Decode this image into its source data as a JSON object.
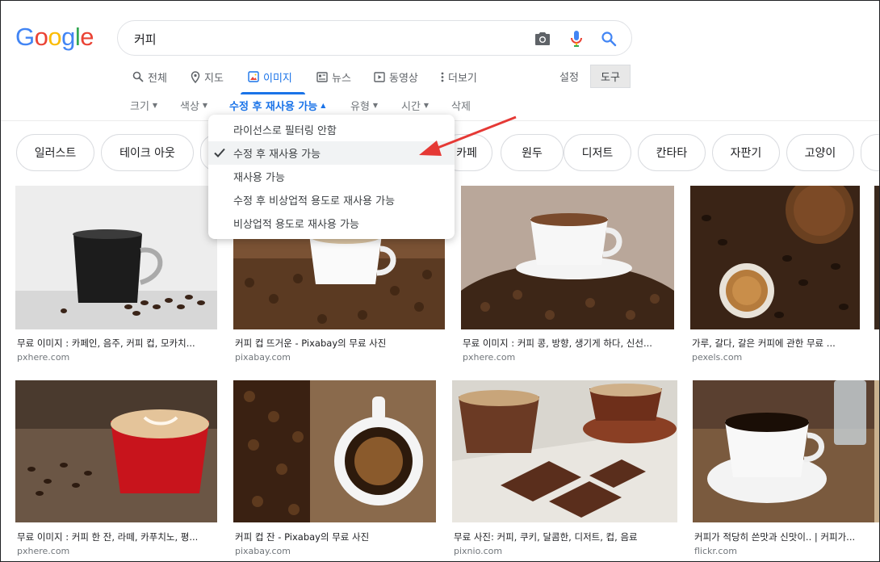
{
  "search": {
    "query": "커피"
  },
  "logo_letters": [
    "G",
    "o",
    "o",
    "g",
    "l",
    "e"
  ],
  "colors": {
    "accent": "#1a73e8",
    "logo": [
      "#4285F4",
      "#EA4335",
      "#FBBC05",
      "#4285F4",
      "#34A853",
      "#EA4335"
    ],
    "arrow": "#e53935"
  },
  "tabs": [
    {
      "label": "전체",
      "icon": "search-icon"
    },
    {
      "label": "지도",
      "icon": "map-pin-icon"
    },
    {
      "label": "이미지",
      "icon": "image-icon",
      "active": true
    },
    {
      "label": "뉴스",
      "icon": "news-icon"
    },
    {
      "label": "동영상",
      "icon": "video-icon"
    },
    {
      "label": "더보기",
      "icon": "more-vert-icon"
    }
  ],
  "settings_label": "설정",
  "tools_label": "도구",
  "filters": [
    "크기",
    "색상",
    "수정 후 재사용 가능",
    "유형",
    "시간",
    "삭제"
  ],
  "dropdown": {
    "items": [
      "라이선스로 필터링 안함",
      "수정 후 재사용 가능",
      "재사용 가능",
      "수정 후 비상업적 용도로 재사용 가능",
      "비상업적 용도로 재사용 가능"
    ],
    "selected_index": 1
  },
  "chips": [
    "일러스트",
    "테이크 아웃",
    "카페",
    "원두",
    "디저트",
    "칸타타",
    "자판기",
    "고양이"
  ],
  "results": [
    {
      "caption": "무료 이미지 : 카페인, 음주, 커피 컵, 모카치...",
      "source": "pxhere.com"
    },
    {
      "caption": "커피 컵 뜨거운 - Pixabay의 무료 사진",
      "source": "pixabay.com"
    },
    {
      "caption": "무료 이미지 : 커피 콩, 방향, 생기게 하다, 신선...",
      "source": "pxhere.com"
    },
    {
      "caption": "가루, 갈다, 갈은 커피에 관한 무료 ...",
      "source": "pexels.com"
    },
    {
      "caption": "무료 이미지 : 커피 한 잔, 라떼, 카푸치노, 평...",
      "source": "pxhere.com"
    },
    {
      "caption": "커피 컵 잔 - Pixabay의 무료 사진",
      "source": "pixabay.com"
    },
    {
      "caption": "무료 사진: 커피, 쿠키, 달콤한, 디저트, 컵, 음료",
      "source": "pixnio.com"
    },
    {
      "caption": "커피가 적당히 쓴맛과 신맛이.. | 커피가...",
      "source": "flickr.com"
    }
  ]
}
